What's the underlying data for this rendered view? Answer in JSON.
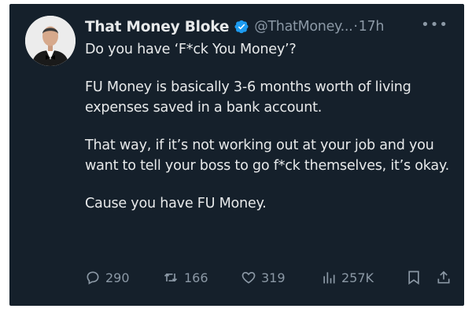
{
  "tweet": {
    "display_name": "That Money Bloke",
    "handle": "@ThatMoney...",
    "separator": "·",
    "time": "17h",
    "more_icon": "more-horizontal-icon",
    "verified_icon": "verified-badge-icon",
    "lines": [
      "Do you have ‘F*ck You Money’?",
      "FU Money is basically 3-6 months worth of living expenses saved in a bank account.",
      "That way, if it’s not working out at your job and you want to tell your boss to go f*ck themselves, it’s okay.",
      "Cause you have FU Money."
    ]
  },
  "actions": {
    "replies": "290",
    "retweets": "166",
    "likes": "319",
    "views": "257K"
  },
  "colors": {
    "background": "#15202b",
    "text": "#e7e9ea",
    "muted": "#8b98a5",
    "verified": "#1d9bf0"
  }
}
